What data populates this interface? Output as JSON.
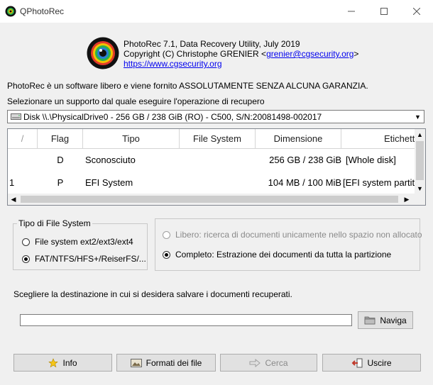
{
  "window": {
    "title": "QPhotoRec"
  },
  "header": {
    "line1": "PhotoRec 7.1, Data Recovery Utility, July 2019",
    "copyright_prefix": "Copyright (C) Christophe GRENIER <",
    "email": "grenier@cgsecurity.org",
    "copyright_suffix": ">",
    "website": "https://www.cgsecurity.org"
  },
  "intro": {
    "license_text": "PhotoRec è un software libero e viene fornito ASSOLUTAMENTE SENZA ALCUNA GARANZIA.",
    "select_media_text": "Selezionare un supporto dal quale eseguire l'operazione di recupero"
  },
  "disk_select": {
    "selected": "Disk \\\\.\\PhysicalDrive0 - 256 GB / 238 GiB (RO) - C500, S/N:20081498-002017"
  },
  "partition_table": {
    "columns": [
      "/",
      "Flag",
      "Tipo",
      "File System",
      "Dimensione",
      "Etichetta"
    ],
    "rows": [
      {
        "num": "",
        "flag": "D",
        "type": "Sconosciuto",
        "fs": "",
        "size": "256 GB / 238 GiB",
        "label": "[Whole disk]"
      },
      {
        "num": "1",
        "flag": "P",
        "type": "EFI System",
        "fs": "",
        "size": "104 MB / 100 MiB",
        "label": "[EFI system partition]"
      }
    ]
  },
  "fs_type": {
    "title": "Tipo di File System",
    "option_ext": "File system ext2/ext3/ext4",
    "option_fat": "FAT/NTFS/HFS+/ReiserFS/...",
    "selected": "fat"
  },
  "scan_mode": {
    "option_free": "Libero: ricerca di documenti unicamente nello spazio non allocato",
    "option_whole": "Completo: Estrazione dei documenti da tutta la partizione",
    "selected": "whole"
  },
  "destination": {
    "prompt": "Scegliere la destinazione in cui si desidera salvare i documenti recuperati.",
    "value": "",
    "browse_label": "Naviga"
  },
  "buttons": {
    "info": "Info",
    "formats": "Formati dei file",
    "search": "Cerca",
    "exit": "Uscire"
  }
}
